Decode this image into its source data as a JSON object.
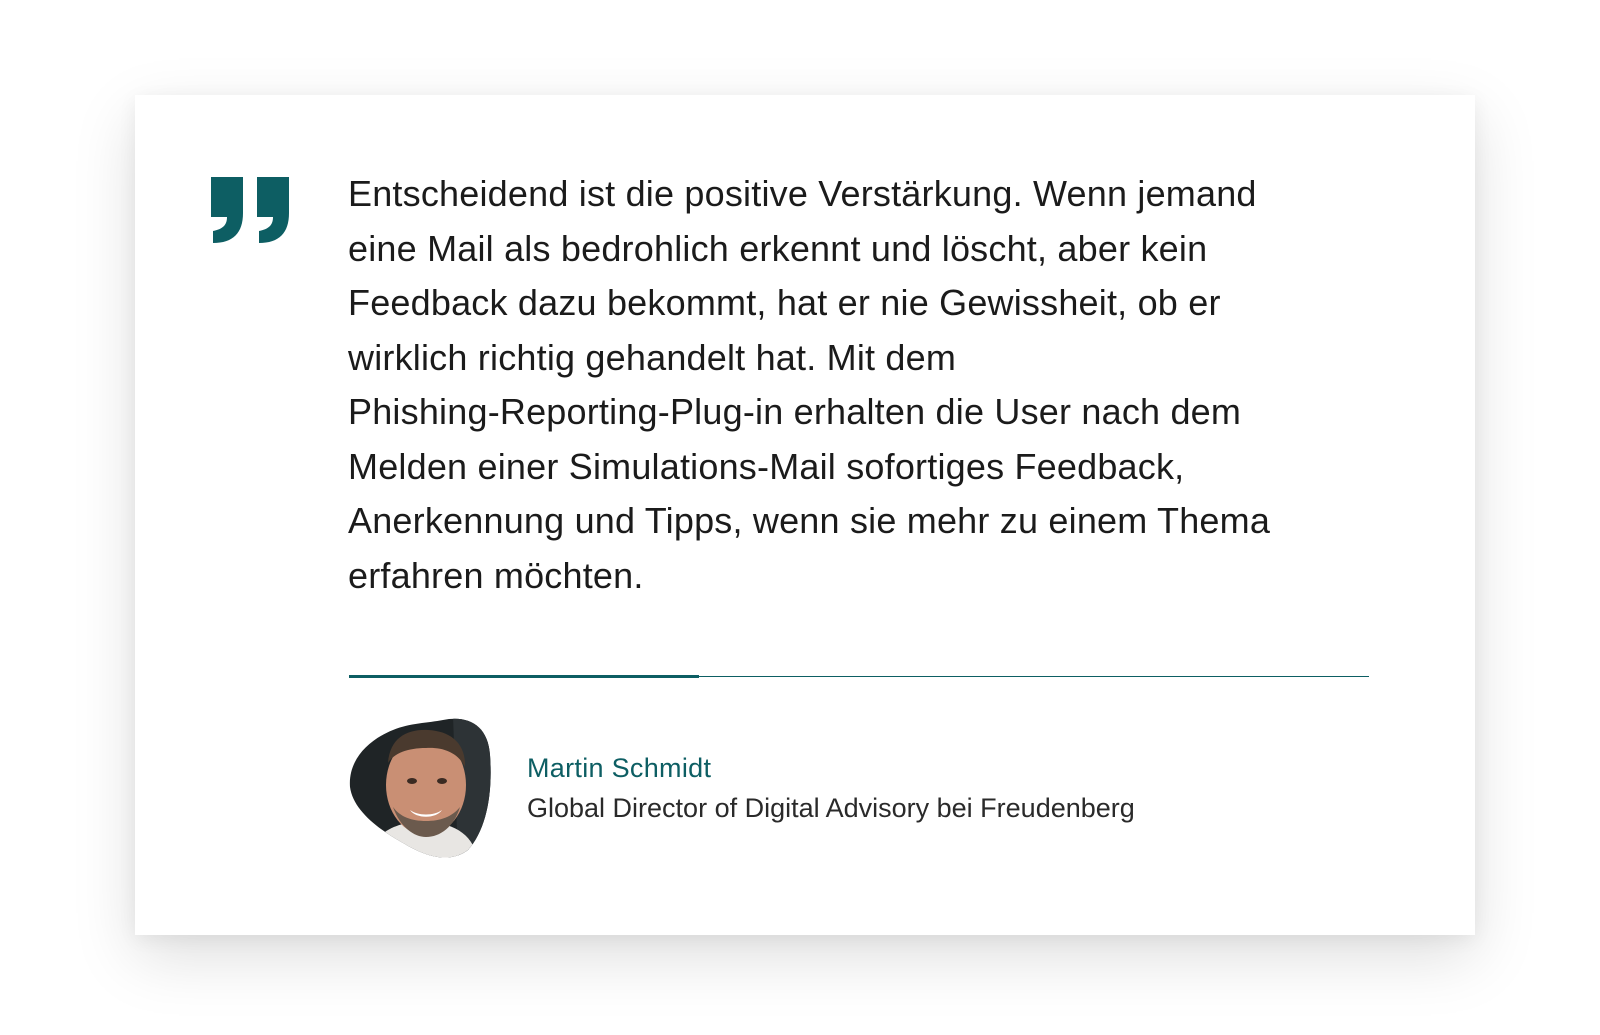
{
  "quote": {
    "text": "Entscheidend ist die positive Verstärkung. Wenn jemand\neine Mail als bedrohlich erkennt und löscht, aber kein\nFeedback dazu bekommt, hat er nie Gewissheit, ob er\nwirklich richtig gehandelt hat. Mit dem\nPhishing-Reporting-Plug-in erhalten die User nach dem\nMelden einer Simulations-Mail sofortiges Feedback,\nAnerkennung und Tipps, wenn sie mehr zu einem Thema\nerfahren möchten."
  },
  "author": {
    "name": "Martin Schmidt",
    "role": "Global Director of Digital Advisory bei Freudenberg",
    "avatar_icon": "portrait-photo"
  },
  "icons": {
    "quote_mark": "closing-quote-icon"
  },
  "colors": {
    "accent": "#0d5e63",
    "text": "#1b1b1b",
    "card": "#ffffff"
  }
}
